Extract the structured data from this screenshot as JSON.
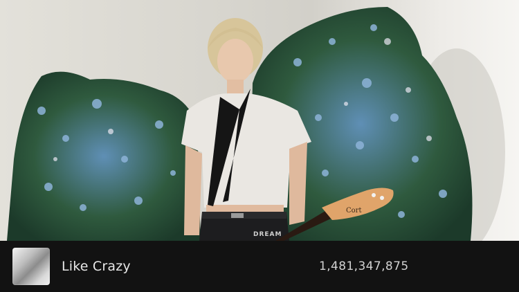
{
  "track": {
    "title": "Like Crazy",
    "play_count": "1,481,347,875"
  },
  "photo": {
    "shirt_print": "DREAM",
    "guitar_brand": "Cort"
  },
  "colors": {
    "bar_background": "#121212",
    "title_text": "#e8e8e8",
    "count_text": "#d2d2d2"
  },
  "icons": {
    "thumbnail": "album-art-thumbnail"
  }
}
